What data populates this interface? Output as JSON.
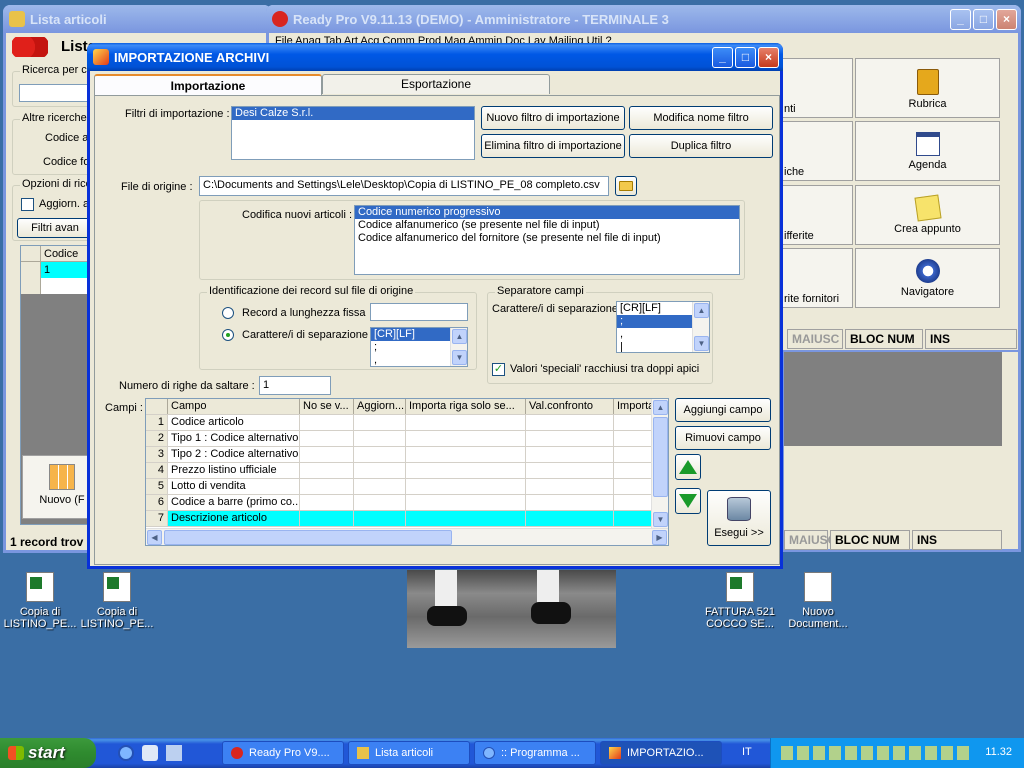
{
  "desktop": {
    "icons": [
      {
        "label": "Copia di LISTINO_PE..."
      },
      {
        "label": "Copia di LISTINO_PE..."
      },
      {
        "label": "FATTURA 521 COCCO SE..."
      },
      {
        "label": "Nuovo Document..."
      }
    ]
  },
  "lista_window": {
    "title": "Lista articoli",
    "heading": "Lista",
    "search_label": "Ricerca per co",
    "other_search_label": "Altre ricerche",
    "codice_a_label": "Codice a",
    "codice_fo_label": "Codice for",
    "options_label": "Opzioni di ricer",
    "aggiorn_label": "Aggiorn. au",
    "filtri_button": "Filtri avan",
    "table_header": "Codice",
    "table_row_value": "1",
    "nuovo_button": "Nuovo (F",
    "status": "1 record trov"
  },
  "readypro_window": {
    "title": "Ready Pro V9.11.13 (DEMO)  - Amministratore - TERMINALE 3",
    "menu_preview": "File  Anag  Tab  Art  Acq  Comm  Prod  Mag  Ammin  Doc  Lav  Mailing  Util  ?",
    "tiles_left": [
      {
        "label": "nti"
      },
      {
        "label": "iche"
      },
      {
        "label": "ifferite"
      },
      {
        "label": "rite fornitori"
      }
    ],
    "tiles_right": [
      {
        "label": "Rubrica"
      },
      {
        "label": "Agenda"
      },
      {
        "label": "Crea appunto"
      },
      {
        "label": "Navigatore"
      }
    ],
    "status1": [
      "MAIUSC",
      "BLOC NUM",
      "INS"
    ],
    "status2": [
      "MAIUSC",
      "BLOC NUM",
      "INS"
    ]
  },
  "dialog": {
    "title": "IMPORTAZIONE ARCHIVI",
    "tabs": [
      {
        "label": "Importazione"
      },
      {
        "label": "Esportazione"
      }
    ],
    "filters_label": "Filtri di importazione :",
    "filters": [
      "Desi Calze S.r.l."
    ],
    "btn_new_filter": "Nuovo filtro di importazione",
    "btn_rename_filter": "Modifica nome filtro",
    "btn_delete_filter": "Elimina filtro di importazione",
    "btn_duplicate_filter": "Duplica filtro",
    "source_label": "File di origine :",
    "source_value": "C:\\Documents and Settings\\Lele\\Desktop\\Copia di LISTINO_PE_08 completo.csv",
    "coding_label": "Codifica nuovi articoli :",
    "coding_options": [
      "Codice numerico progressivo",
      "Codice alfanumerico (se presente nel file di input)",
      "Codice alfanumerico del fornitore (se presente nel file di input)"
    ],
    "record_group_title": "Identificazione dei record sul file di origine",
    "radio_fixed": "Record a lunghezza fissa",
    "radio_separator": "Carattere/i di separazione",
    "record_sep_options": [
      "[CR][LF]",
      ";",
      ","
    ],
    "fields_sep_group_title": "Separatore campi",
    "fields_sep_label": "Carattere/i di separazione",
    "fields_sep_options": [
      "[CR][LF]",
      ";",
      ",",
      "|"
    ],
    "quotes_label": "Valori 'speciali' racchiusi tra doppi apici",
    "skip_label": "Numero di righe da saltare  :",
    "skip_value": "1",
    "fields_label": "Campi :",
    "columns": [
      "Campo",
      "No se v...",
      "Aggiorn...",
      "Importa riga solo se...",
      "Val.confronto",
      "Importa"
    ],
    "rows": [
      {
        "n": "1",
        "campo": "Codice articolo"
      },
      {
        "n": "2",
        "campo": "Tipo 1 : Codice alternativo"
      },
      {
        "n": "3",
        "campo": "Tipo 2 : Codice alternativo"
      },
      {
        "n": "4",
        "campo": "Prezzo listino ufficiale"
      },
      {
        "n": "5",
        "campo": "Lotto di vendita"
      },
      {
        "n": "6",
        "campo": "Codice a barre (primo co..."
      },
      {
        "n": "7",
        "campo": "Descrizione articolo"
      }
    ],
    "btn_add_field": "Aggiungi campo",
    "btn_remove_field": "Rimuovi campo",
    "btn_execute": "Esegui >>"
  },
  "taskbar": {
    "start": "start",
    "items": [
      {
        "label": "Ready Pro V9...."
      },
      {
        "label": "Lista articoli"
      },
      {
        "label": ":: Programma ..."
      },
      {
        "label": "IMPORTAZIO..."
      }
    ],
    "lang": "IT",
    "clock": "11.32"
  }
}
